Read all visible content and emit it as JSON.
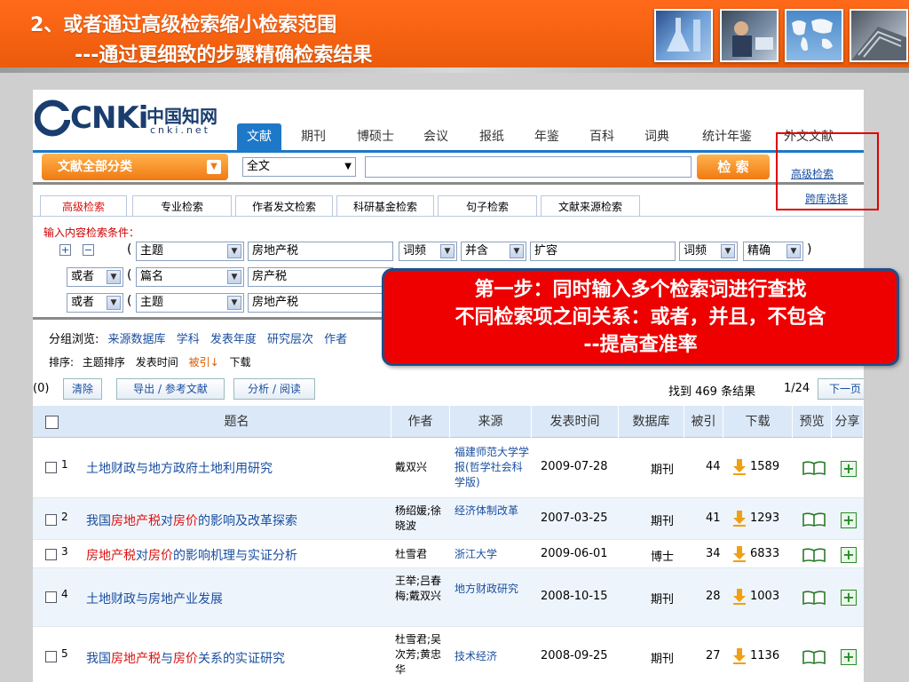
{
  "slide": {
    "title_line1": "2、或者通过高级检索缩小检索范围",
    "title_line2": "---通过更细致的步骤精确检索结果"
  },
  "cnki": {
    "logo_main": "CNKi",
    "logo_cn": "中国知网",
    "logo_url": "cnki.net",
    "tabs": [
      "文献",
      "期刊",
      "博硕士",
      "会议",
      "报纸",
      "年鉴",
      "百科",
      "词典",
      "统计年鉴",
      "外文文献"
    ],
    "category_button": "文献全部分类",
    "field_select": "全文",
    "search_value": "",
    "search_button": "检 索",
    "advanced_link": "高级检索",
    "cross_db_link": "跨库选择",
    "search_tabs": [
      "高级检索",
      "专业检索",
      "作者发文检索",
      "科研基金检索",
      "句子检索",
      "文献来源检索"
    ],
    "conditions_label": "输入内容检索条件：",
    "rows": [
      {
        "logic": "",
        "field": "主题",
        "value": "房地产税",
        "freq": "词频",
        "op": "并含",
        "value2": "扩容",
        "freq2": "词频",
        "match": "精确",
        "close": ")"
      },
      {
        "logic": "或者",
        "field": "篇名",
        "value": "房产税"
      },
      {
        "logic": "或者",
        "field": "主题",
        "value": "房地产税"
      }
    ],
    "group_label": "分组浏览:",
    "group_items": [
      "来源数据库",
      "学科",
      "发表年度",
      "研究层次",
      "作者"
    ],
    "sort_label": "排序:",
    "sort_items": [
      "主题排序",
      "发表时间",
      "被引",
      "下载"
    ],
    "selected_count": "(0)",
    "clear_button": "清除",
    "export_button": "导出 / 参考文献",
    "analyze_button": "分析 / 阅读",
    "found_text": "找到 469 条结果",
    "page_info": "1/24",
    "next_page": "下一页",
    "columns": [
      "题名",
      "作者",
      "来源",
      "发表时间",
      "数据库",
      "被引",
      "下载",
      "预览",
      "分享"
    ],
    "results": [
      {
        "no": "1",
        "title": "土地财政与地方政府土地利用研究",
        "author": "戴双兴",
        "source": "福建师范大学学报(哲学社会科学版)",
        "date": "2009-07-28",
        "db": "期刊",
        "cited": "44",
        "downloads": "1589"
      },
      {
        "no": "2",
        "title": "我国房地产税对房价的影响及改革探索",
        "author": "杨绍媛;徐晓波",
        "source": "经济体制改革",
        "date": "2007-03-25",
        "db": "期刊",
        "cited": "41",
        "downloads": "1293"
      },
      {
        "no": "3",
        "title": "房地产税对房价的影响机理与实证分析",
        "author": "杜雪君",
        "source": "浙江大学",
        "date": "2009-06-01",
        "db": "博士",
        "cited": "34",
        "downloads": "6833"
      },
      {
        "no": "4",
        "title": "土地财政与房地产业发展",
        "author": "王举;吕春梅;戴双兴",
        "source": "地方财政研究",
        "date": "2008-10-15",
        "db": "期刊",
        "cited": "28",
        "downloads": "1003"
      },
      {
        "no": "5",
        "title": "我国房地产税与房价关系的实证研究",
        "author": "杜雪君;吴次芳;黄忠华",
        "source": "技术经济",
        "date": "2008-09-25",
        "db": "期刊",
        "cited": "27",
        "downloads": "1136"
      }
    ]
  },
  "callout": {
    "line1": "第一步：同时输入多个检索词进行查找",
    "line2": "不同检索项之间关系：或者，并且，不包含",
    "line3": "--提高查准率"
  },
  "colors": {
    "header_orange": "#f26010",
    "callout_red": "#ee0000",
    "tab_blue": "#1d78c8",
    "link_blue": "#1a4fa0",
    "highlight_red": "#e00000"
  }
}
